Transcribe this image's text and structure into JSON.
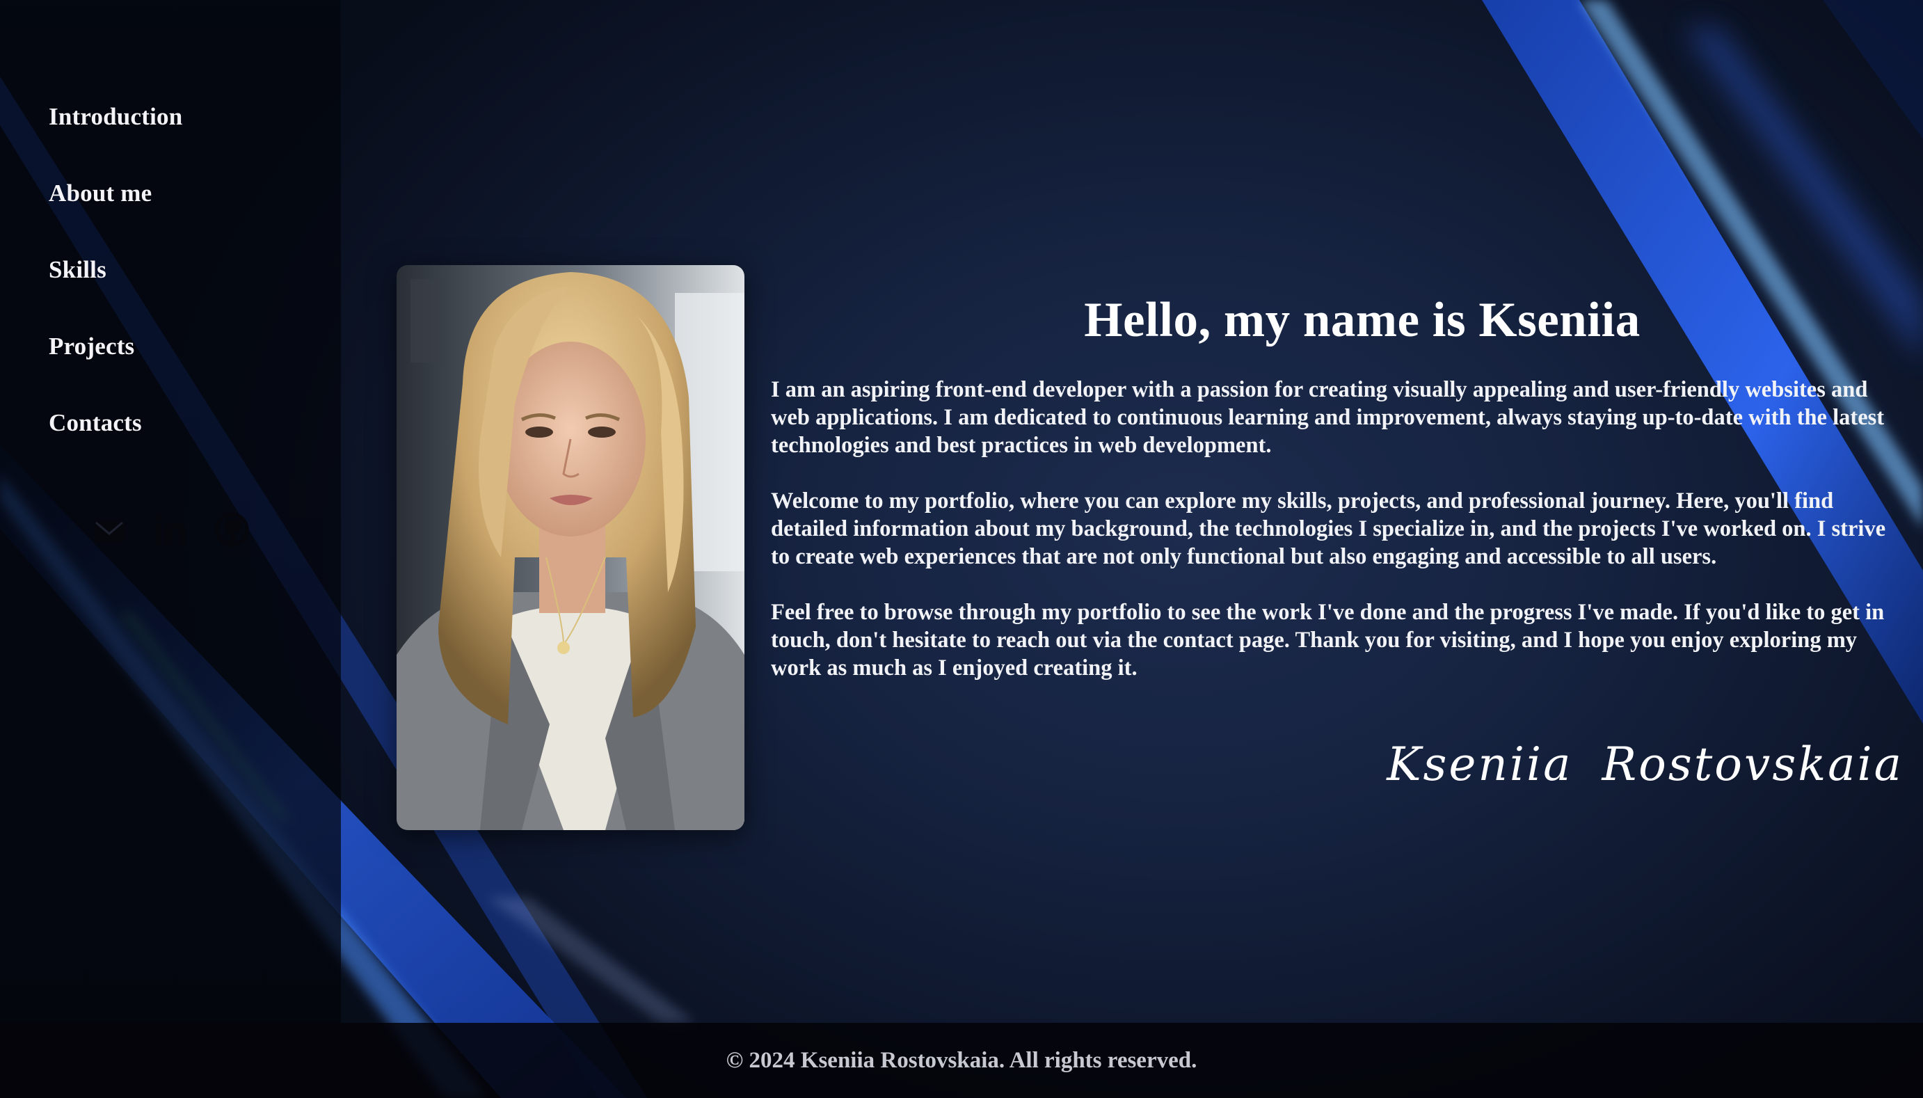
{
  "nav": {
    "items": [
      {
        "label": "Introduction"
      },
      {
        "label": "About me"
      },
      {
        "label": "Skills"
      },
      {
        "label": "Projects"
      },
      {
        "label": "Contacts"
      }
    ]
  },
  "social": {
    "icons": [
      "mail-icon",
      "linkedin-icon",
      "github-icon"
    ]
  },
  "intro": {
    "title": "Hello, my name is Kseniia",
    "paragraphs": [
      "I am an aspiring front-end developer with a passion for creating visually appealing and user-friendly websites and web applications. I am dedicated to continuous learning and improvement, always staying up-to-date with the latest technologies and best practices in web development.",
      "Welcome to my portfolio, where you can explore my skills, projects, and professional journey. Here, you'll find detailed information about my background, the technologies I specialize in, and the projects I've worked on. I strive to create web experiences that are not only functional but also engaging and accessible to all users.",
      "Feel free to browse through my portfolio to see the work I've done and the progress I've made. If you'd like to get in touch, don't hesitate to reach out via the contact page. Thank you for visiting, and I hope you enjoy exploring my work as much as I enjoyed creating it."
    ],
    "signature": "Kseniia Rostovskaia"
  },
  "footer": {
    "text": "© 2024 Kseniia Rostovskaia. All rights reserved."
  },
  "colors": {
    "background": "#15223f",
    "beam": "#2f63e6",
    "beam_glow": "#5fa8ff",
    "text": "#ffffff"
  }
}
